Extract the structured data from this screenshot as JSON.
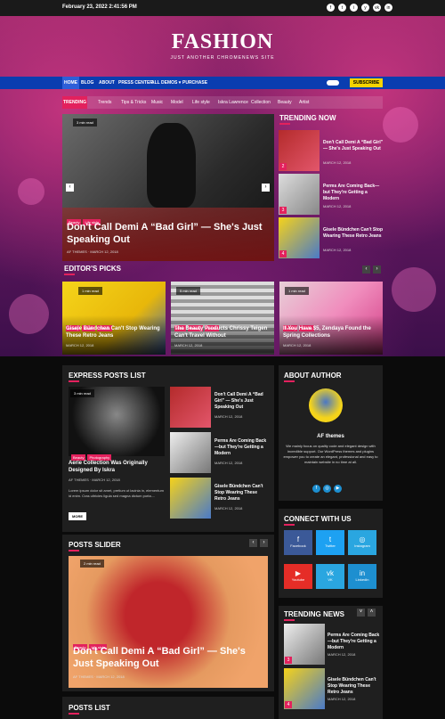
{
  "topbar": {
    "date": "February 23, 2022 2:41:56 PM",
    "social": [
      "f",
      "t",
      "i",
      "y",
      "vk",
      "in"
    ]
  },
  "brand": {
    "title": "FASHION",
    "tagline": "JUST ANOTHER CHROMENEWS SITE"
  },
  "nav": {
    "items": [
      "HOME",
      "BLOG",
      "ABOUT",
      "PRESS CENTER",
      "ALL DEMOS ▾",
      "PURCHASE"
    ],
    "subscribe": "SUBSCRIBE"
  },
  "trending_bar": {
    "label": "TRENDING",
    "tags": [
      "Trends",
      "Tips & Tricks",
      "Music",
      "Model",
      "Life style",
      "Iskra Lawrence",
      "Collection",
      "Beauty",
      "Artist"
    ]
  },
  "slider": {
    "read": "3 min read",
    "badges": [
      "Beauty",
      "Life style"
    ],
    "title": "Don't Call Demi A “Bad Girl” — She's Just Speaking Out",
    "author": "AF THEMES",
    "date": "MARCH 12, 2018",
    "prev": "‹",
    "next": "›"
  },
  "trending_now": {
    "heading": "TRENDING NOW",
    "items": [
      {
        "num": "2",
        "title": "Don't Call Demi A “Bad Girl” — She's Just Speaking Out",
        "date": "MARCH 12, 2018"
      },
      {
        "num": "3",
        "title": "Perms Are Coming Back—but They're Getting a Modern",
        "date": "MARCH 12, 2018"
      },
      {
        "num": "4",
        "title": "Gisele Bündchen Can't Stop Wearing These Retro Jeans",
        "date": "MARCH 12, 2018"
      }
    ]
  },
  "editors_picks": {
    "heading": "EDITOR'S PICKS",
    "items": [
      {
        "read": "1 min read",
        "badges": [
          "Beauty",
          "Model",
          "Trends"
        ],
        "title": "Gisele Bündchen Can't Stop Wearing These Retro Jeans",
        "date": "MARCH 12, 2018"
      },
      {
        "read": "5 min read",
        "badges": [
          "Artist",
          "Beauty",
          "Trends"
        ],
        "title": "The Beauty Products Chrissy Teigen Can't Travel Without",
        "date": "MARCH 12, 2018"
      },
      {
        "read": "1 min read",
        "badges": [
          "Beauty",
          "Trends"
        ],
        "title": "If You Have $5, Zendaya Found the Spring Collections",
        "date": "MARCH 12, 2018"
      }
    ]
  },
  "express": {
    "heading": "EXPRESS POSTS LIST",
    "main": {
      "read": "3 min read",
      "badges": [
        "Beauty",
        "Photography"
      ],
      "title": "Aerie Collection Was Originally Designed By Iskra",
      "author": "AF THEMES",
      "date": "MARCH 12, 2018",
      "excerpt": "Lorem ipsum dolor sit amet, pretium ut lacinia in, elementum id enim. Cras ultricies ligula sed magna dictum porta....",
      "more": "MORE"
    },
    "items": [
      {
        "title": "Don't Call Demi A “Bad Girl” — She's Just Speaking Out",
        "date": "MARCH 12, 2018"
      },
      {
        "title": "Perms Are Coming Back—but They're Getting a Modern",
        "date": "MARCH 12, 2018"
      },
      {
        "title": "Gisele Bündchen Can't Stop Wearing These Retro Jeans",
        "date": "MARCH 12, 2018"
      }
    ]
  },
  "about": {
    "heading": "ABOUT AUTHOR",
    "name": "AF themes",
    "text": "We mainly focus on quality code and elegant design with incredible support. Our WordPress themes and plugins empower you to create an elegant, professional and easy to maintain website in no time at all."
  },
  "connect": {
    "heading": "CONNECT WITH US",
    "items": [
      {
        "icon": "f",
        "label": "Facebook",
        "color": "#3b5998"
      },
      {
        "icon": "t",
        "label": "Twitter",
        "color": "#1da1f2"
      },
      {
        "icon": "◎",
        "label": "Instagram",
        "color": "#2aa6e0"
      },
      {
        "icon": "▶",
        "label": "Youtube",
        "color": "#e52d27"
      },
      {
        "icon": "vk",
        "label": "VK",
        "color": "#2aa6e0"
      },
      {
        "icon": "in",
        "label": "Linkedin",
        "color": "#1d8fd0"
      }
    ]
  },
  "posts_slider": {
    "heading": "POSTS SLIDER",
    "read": "2 min read",
    "badges": [
      "Beauty",
      "Life style"
    ],
    "title": "Don't Call Demi A “Bad Girl” — She's Just Speaking Out",
    "author": "AF THEMES",
    "date": "MARCH 12, 2018"
  },
  "trending_news": {
    "heading": "TRENDING NEWS",
    "items": [
      {
        "num": "3",
        "title": "Perms Are Coming Back—but They're Getting a Modern",
        "date": "MARCH 12, 2018"
      },
      {
        "num": "4",
        "title": "Gisele Bündchen Can't Stop Wearing These Retro Jeans",
        "date": "MARCH 12, 2018"
      }
    ]
  },
  "posts_list": {
    "heading": "POSTS LIST"
  }
}
